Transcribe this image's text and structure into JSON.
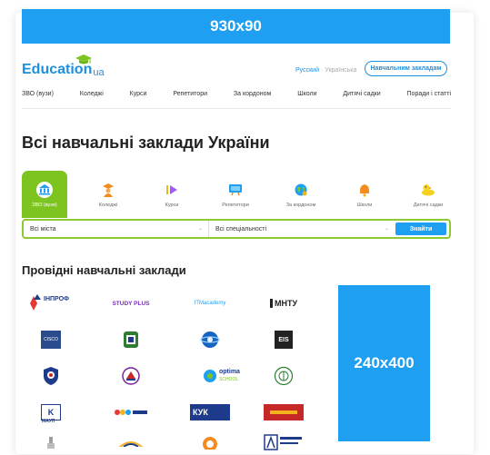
{
  "banner_top": {
    "text": "930x90"
  },
  "banner_side": {
    "text": "240x400"
  },
  "header": {
    "logo_text": "Education",
    "logo_suffix": "ua",
    "lang_ru": "Русский",
    "lang_sep": "·",
    "lang_uk": "Українська",
    "institutions_button": "Навчальним закладам"
  },
  "nav": {
    "items": [
      "ЗВО (вузи)",
      "Коледжі",
      "Курси",
      "Репетитори",
      "За кордоном",
      "Школи",
      "Дитячі садки",
      "Поради і статті"
    ]
  },
  "page_title": "Всі навчальні заклади України",
  "categories": [
    {
      "label": "ЗВО (вузи)",
      "icon": "university-icon",
      "active": true
    },
    {
      "label": "Коледжі",
      "icon": "graduate-icon"
    },
    {
      "label": "Курси",
      "icon": "play-icon"
    },
    {
      "label": "Репетитори",
      "icon": "board-icon"
    },
    {
      "label": "За кордоном",
      "icon": "globe-icon"
    },
    {
      "label": "Школи",
      "icon": "bell-icon"
    },
    {
      "label": "Дитячі садки",
      "icon": "duck-icon"
    }
  ],
  "search": {
    "city_value": "Всі міста",
    "specialty_value": "Всі спеціальності",
    "find_button": "Знайти"
  },
  "section_title": "Провідні навчальні заклади",
  "logo_texts": {
    "inprof": "ІНПРОФ",
    "studyplus": "STUDY PLUS",
    "itmacademy": "ITMacademy",
    "mntu": "МНТУ",
    "cisco": "CISCO",
    "eis": "EIS",
    "optima": "optima",
    "optima_sub": "SCHOOL",
    "mauq": "МАУП",
    "kuk": "КУК"
  },
  "colors": {
    "accent": "#1e9ff2",
    "green": "#7ec421"
  }
}
